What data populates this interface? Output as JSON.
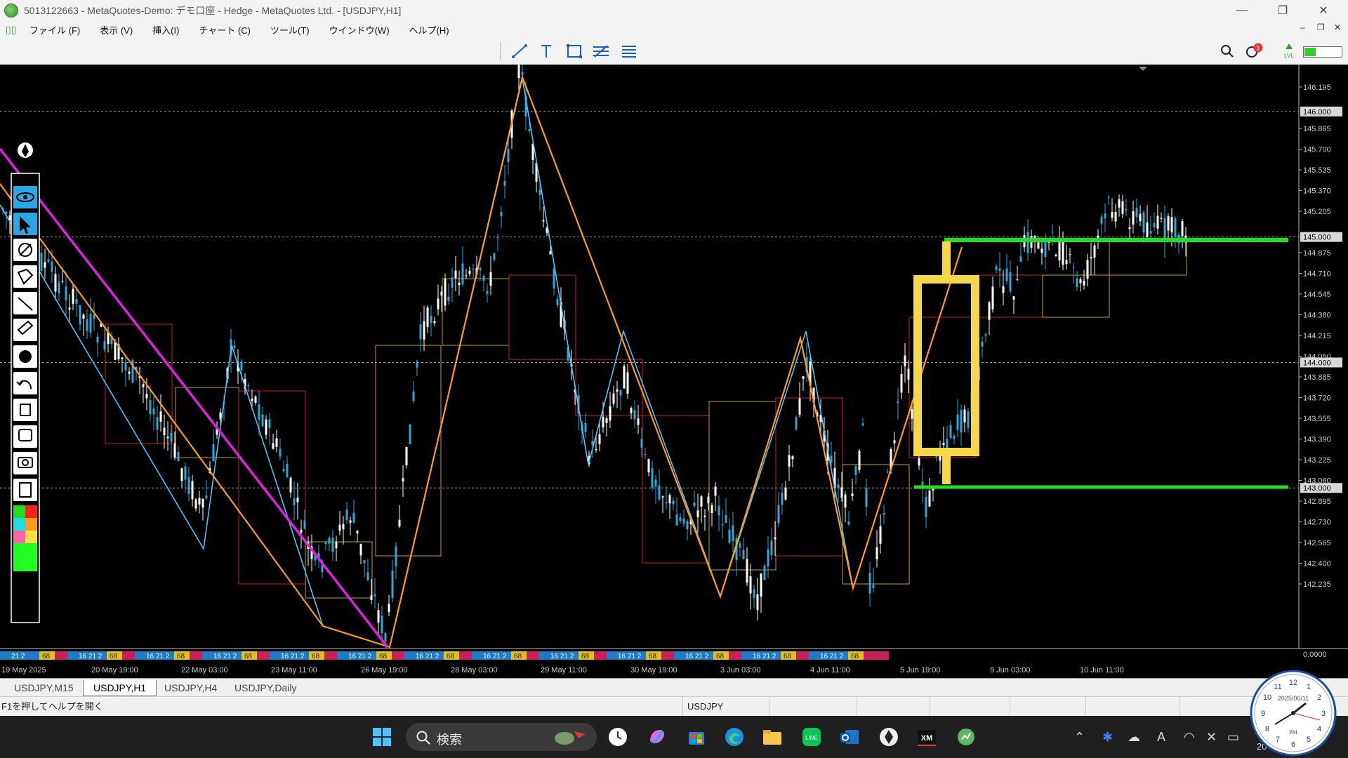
{
  "window": {
    "title": "5013122663 - MetaQuotes-Demo: デモ口座 - Hedge - MetaQuotes Ltd. - [USDJPY,H1]",
    "minimize": "—",
    "maximize": "❐",
    "close": "✕"
  },
  "menu": [
    "ファイル (F)",
    "表示 (V)",
    "挿入(I)",
    "チャート (C)",
    "ツール(T)",
    "ウインドウ(W)",
    "ヘルプ(H)"
  ],
  "mdi": {
    "minimize": "–",
    "restore": "❐",
    "close": "✕"
  },
  "toolbar": {
    "notification_count": "1",
    "lvl_label": "LVL"
  },
  "chart": {
    "symbol": "USDJPY",
    "timeframe": "H1",
    "price_labels": [
      "146.195",
      "145.865",
      "145.700",
      "145.535",
      "145.370",
      "145.205",
      "144.875",
      "144.710",
      "144.545",
      "144.380",
      "144.215",
      "144.050",
      "143.885",
      "143.720",
      "143.555",
      "143.390",
      "143.225",
      "143.060",
      "142.895",
      "142.730",
      "142.565",
      "142.400",
      "142.235"
    ],
    "highlighted_levels": [
      "146.000",
      "145.000",
      "144.000",
      "143.000"
    ],
    "sub_window_value": "0.0000",
    "time_labels": [
      "19 May 2025",
      "20 May 19:00",
      "22 May 03:00",
      "23 May 11:00",
      "26 May 19:00",
      "28 May 03:00",
      "29 May 11:00",
      "30 May 19:00",
      "3 Jun 03:00",
      "4 Jun 11:00",
      "5 Jun 19:00",
      "9 Jun 03:00",
      "10 Jun 11:00"
    ],
    "session_labels": [
      "21 2",
      "68",
      "16 21 2",
      "68"
    ],
    "colors": {
      "bull_candle": "#ffffff",
      "bear_candle": "#2fa8d8",
      "zigzag_orange": "#ff9a1f",
      "zigzag_cyan": "#4fc3f7",
      "trendline": "#e020e0",
      "horizontal_lines": "#22dd22",
      "candle_drawing": "#f5d84a",
      "box_red": "#d02020",
      "box_gold": "#c8a020"
    }
  },
  "left_tools": [
    "pen-icon",
    "eye-icon",
    "cursor-icon",
    "eraser-icon",
    "tag-icon",
    "line-icon",
    "ruler-icon",
    "dot-icon",
    "undo-icon",
    "trash-icon",
    "train-icon",
    "camera-icon",
    "clipboard-icon"
  ],
  "palette": [
    "#22dd22",
    "#ff2020",
    "#22dddd",
    "#ff9a1f",
    "#ff66aa",
    "#ffdd44",
    "#22ff22"
  ],
  "tabs": [
    "USDJPY,M15",
    "USDJPY,H1",
    "USDJPY,H4",
    "USDJPY,Daily"
  ],
  "active_tab": "USDJPY,H1",
  "status": {
    "help": "F1を押してヘルプを開く",
    "symbol": "USDJPY"
  },
  "taskbar": {
    "search_label": "検索",
    "clock_date": "2025/06/11",
    "clock_pm": "PM",
    "tray_time_partial": "20"
  }
}
